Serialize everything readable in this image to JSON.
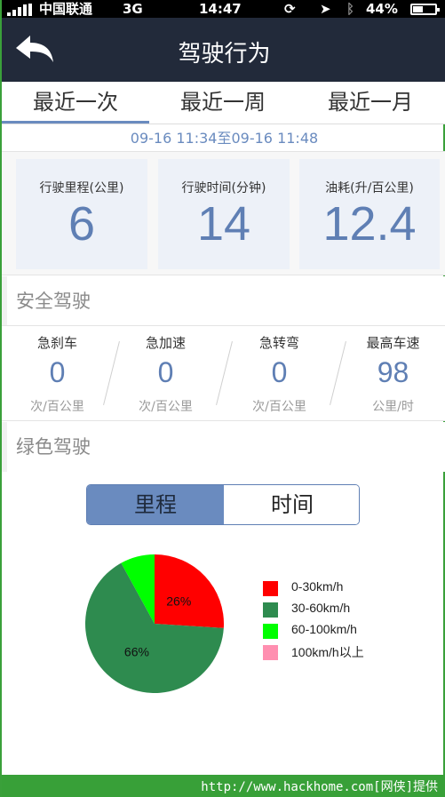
{
  "status_bar": {
    "carrier": "中国联通",
    "network": "3G",
    "time": "14:47",
    "battery": "44%",
    "battery_level": 0.44
  },
  "nav": {
    "title": "驾驶行为",
    "back_icon": "back-arrow-icon"
  },
  "tabs": [
    {
      "label": "最近一次",
      "active": true
    },
    {
      "label": "最近一周",
      "active": false
    },
    {
      "label": "最近一月",
      "active": false
    }
  ],
  "date_range": "09-16 11:34至09-16 11:48",
  "stats": [
    {
      "label": "行驶里程(公里)",
      "value": "6"
    },
    {
      "label": "行驶时间(分钟)",
      "value": "14"
    },
    {
      "label": "油耗(升/百公里)",
      "value": "12.4"
    }
  ],
  "safe_driving": {
    "title": "安全驾驶",
    "items": [
      {
        "label": "急刹车",
        "value": "0",
        "unit": "次/百公里"
      },
      {
        "label": "急加速",
        "value": "0",
        "unit": "次/百公里"
      },
      {
        "label": "急转弯",
        "value": "0",
        "unit": "次/百公里"
      },
      {
        "label": "最高车速",
        "value": "98",
        "unit": "公里/时"
      }
    ]
  },
  "green_driving": {
    "title": "绿色驾驶",
    "segments": [
      {
        "label": "里程",
        "active": true
      },
      {
        "label": "时间",
        "active": false
      }
    ]
  },
  "chart_data": {
    "type": "pie",
    "slices": [
      {
        "name": "0-30km/h",
        "value": 26,
        "color": "#ff0000",
        "label": "26%"
      },
      {
        "name": "30-60km/h",
        "value": 66,
        "color": "#2e8b4f",
        "label": "66%"
      },
      {
        "name": "60-100km/h",
        "value": 8,
        "color": "#00ff00",
        "label": ""
      },
      {
        "name": "100km/h以上",
        "value": 0,
        "color": "#ff8fb0",
        "label": ""
      }
    ],
    "legend_position": "right"
  },
  "footer": {
    "text": "http://www.hackhome.com[网侠]提供"
  }
}
